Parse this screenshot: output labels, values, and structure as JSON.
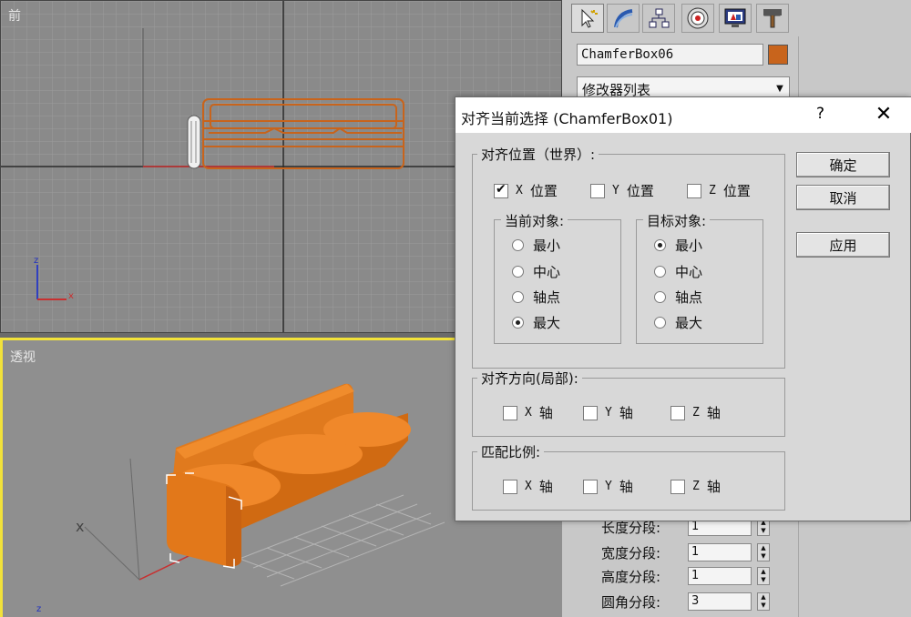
{
  "viewports": {
    "front_label": "前",
    "persp_label": "透视"
  },
  "command_panel": {
    "tabs": [
      "create-icon",
      "modify-icon",
      "hierarchy-icon",
      "motion-icon",
      "display-icon",
      "utilities-icon"
    ],
    "object_name": "ChamferBox06",
    "object_color": "#c8641c",
    "modifier_list": "修改器列表",
    "params": [
      {
        "label": "长度分段:",
        "value": "1"
      },
      {
        "label": "宽度分段:",
        "value": "1"
      },
      {
        "label": "高度分段:",
        "value": "1"
      },
      {
        "label": "圆角分段:",
        "value": "3"
      }
    ]
  },
  "dialog": {
    "title": "对齐当前选择 (ChamferBox01)",
    "help": "?",
    "close": "✕",
    "align_position": {
      "title": "对齐位置（世界）:",
      "x": {
        "axis": "X",
        "label": "位置",
        "checked": true
      },
      "y": {
        "axis": "Y",
        "label": "位置",
        "checked": false
      },
      "z": {
        "axis": "Z",
        "label": "位置",
        "checked": false
      }
    },
    "current_object": {
      "title": "当前对象:",
      "options": [
        "最小",
        "中心",
        "轴点",
        "最大"
      ],
      "selected": "最大"
    },
    "target_object": {
      "title": "目标对象:",
      "options": [
        "最小",
        "中心",
        "轴点",
        "最大"
      ],
      "selected": "最小"
    },
    "align_orientation": {
      "title": "对齐方向(局部):",
      "x": {
        "axis": "X",
        "label": "轴"
      },
      "y": {
        "axis": "Y",
        "label": "轴"
      },
      "z": {
        "axis": "Z",
        "label": "轴"
      }
    },
    "match_scale": {
      "title": "匹配比例:",
      "x": {
        "axis": "X",
        "label": "轴"
      },
      "y": {
        "axis": "Y",
        "label": "轴"
      },
      "z": {
        "axis": "Z",
        "label": "轴"
      }
    },
    "buttons": {
      "ok": "确定",
      "cancel": "取消",
      "apply": "应用"
    }
  }
}
